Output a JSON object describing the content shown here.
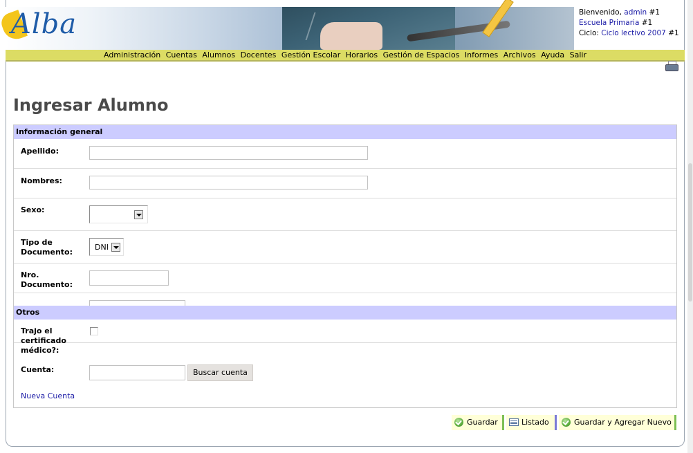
{
  "header": {
    "logo_text": "Alba",
    "welcome_prefix": "Bienvenido,",
    "user": "admin",
    "user_suffix": "#1",
    "school": "Escuela Primaria",
    "school_suffix": "#1",
    "cycle_prefix": "Ciclo:",
    "cycle": "Ciclo lectivo 2007",
    "cycle_suffix": "#1"
  },
  "menu": {
    "items": [
      "Administración",
      "Cuentas",
      "Alumnos",
      "Docentes",
      "Gestión Escolar",
      "Horarios",
      "Gestión de Espacios",
      "Informes",
      "Archivos",
      "Ayuda",
      "Salir"
    ]
  },
  "page": {
    "title": "Ingresar Alumno"
  },
  "form": {
    "section_general": "Información general",
    "apellido_label": "Apellido:",
    "apellido_value": "",
    "nombres_label": "Nombres:",
    "nombres_value": "",
    "sexo_label": "Sexo:",
    "sexo_value": "",
    "tipo_doc_label": "Tipo de Documento:",
    "tipo_doc_value": "DNI",
    "nro_doc_label": "Nro. Documento:",
    "nro_doc_value": "",
    "section_otros": "Otros",
    "certificado_label": "Trajo el certificado médico?:",
    "certificado_checked": false,
    "cuenta_label": "Cuenta:",
    "cuenta_value": "",
    "buscar_cuenta": "Buscar cuenta",
    "nueva_cuenta": "Nueva Cuenta"
  },
  "actions": {
    "guardar": "Guardar",
    "listado": "Listado",
    "guardar_agregar": "Guardar y Agregar Nuevo"
  },
  "colors": {
    "menubar": "#dcdc64",
    "section_header": "#ccccff",
    "link": "#1a1aa6",
    "action_bg": "#ffffd8"
  }
}
